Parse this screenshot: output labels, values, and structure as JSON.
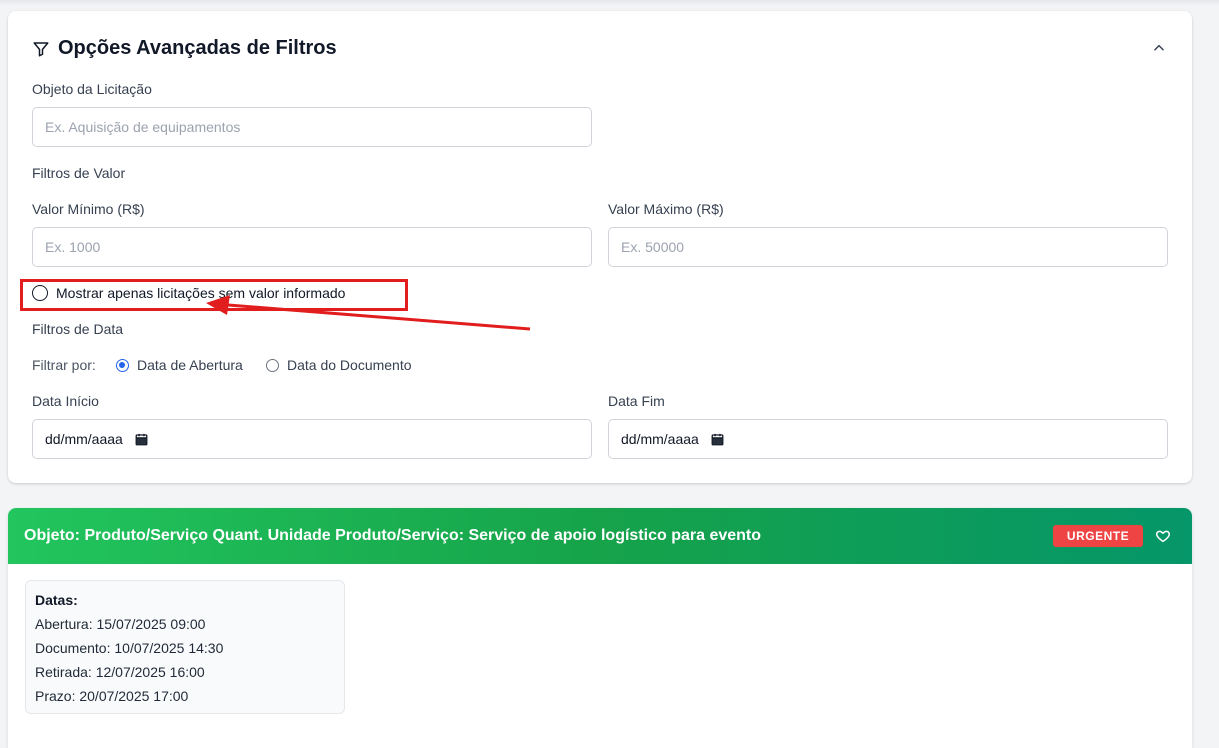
{
  "filters": {
    "title": "Opções Avançadas de Filtros",
    "objeto_label": "Objeto da Licitação",
    "objeto_placeholder": "Ex. Aquisição de equipamentos",
    "valor_section": "Filtros de Valor",
    "valor_min_label": "Valor Mínimo (R$)",
    "valor_min_placeholder": "Ex. 1000",
    "valor_max_label": "Valor Máximo (R$)",
    "valor_max_placeholder": "Ex. 50000",
    "sem_valor_label": "Mostrar apenas licitações sem valor informado",
    "data_section": "Filtros de Data",
    "filtrar_por_label": "Filtrar por:",
    "radio_abertura": "Data de Abertura",
    "radio_documento": "Data do Documento",
    "selected_filter": "Data de Abertura",
    "data_inicio_label": "Data Início",
    "data_inicio_value": "dd/mm/aaaa",
    "data_fim_label": "Data Fim",
    "data_fim_value": "dd/mm/aaaa"
  },
  "result": {
    "title": "Objeto: Produto/Serviço Quant. Unidade Produto/Serviço: Serviço de apoio logístico para evento",
    "badge": "URGENTE",
    "dates_title": "Datas:",
    "dates": [
      "Abertura: 15/07/2025 09:00",
      "Documento: 10/07/2025 14:30",
      "Retirada: 12/07/2025 16:00",
      "Prazo: 20/07/2025 17:00"
    ]
  },
  "colors": {
    "annotation_red": "#e11d1d",
    "header_green": "#16a34a",
    "badge_red": "#ef4444",
    "radio_blue": "#2563eb"
  },
  "icons": [
    "filter-icon",
    "chevron-up-icon",
    "calendar-icon",
    "heart-icon",
    "arrow-annotation"
  ]
}
